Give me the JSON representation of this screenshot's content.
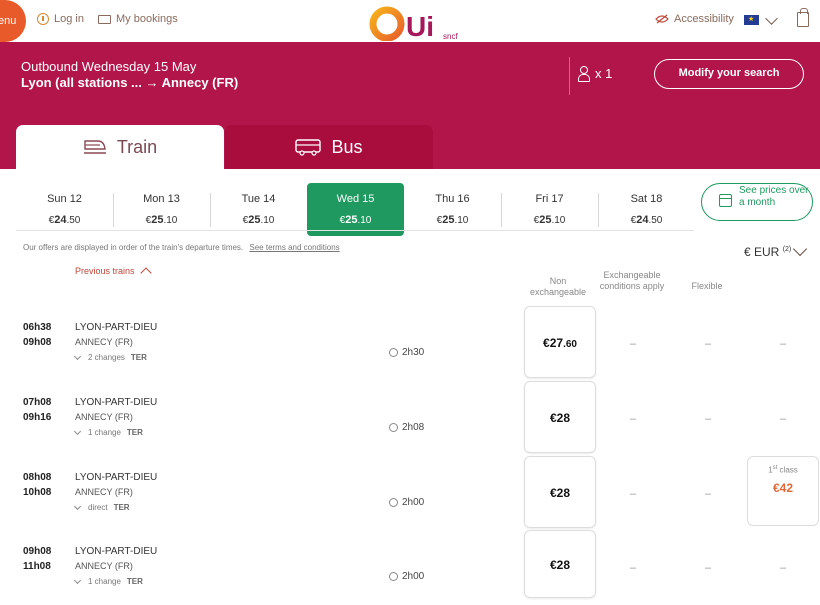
{
  "header": {
    "menu_label": "enu",
    "login_label": "Log in",
    "bookings_label": "My bookings",
    "logo_text": "Ui",
    "logo_sub": "sncf",
    "accessibility_label": "Accessibility"
  },
  "search": {
    "outbound": "Outbound Wednesday 15 May",
    "route": "Lyon (all stations ... → Annecy (FR)",
    "passengers": "x 1",
    "modify_label": "Modify your search"
  },
  "modes": [
    {
      "label": "Train"
    },
    {
      "label": "Bus"
    }
  ],
  "dates": [
    {
      "day": "Sun 12",
      "cur": "€",
      "int": "24",
      "dec": ".50"
    },
    {
      "day": "Mon 13",
      "cur": "€",
      "int": "25",
      "dec": ".10"
    },
    {
      "day": "Tue 14",
      "cur": "€",
      "int": "25",
      "dec": ".10"
    },
    {
      "day": "Wed 15",
      "cur": "€",
      "int": "25",
      "dec": ".10"
    },
    {
      "day": "Thu 16",
      "cur": "€",
      "int": "25",
      "dec": ".10"
    },
    {
      "day": "Fri 17",
      "cur": "€",
      "int": "25",
      "dec": ".10"
    },
    {
      "day": "Sat 18",
      "cur": "€",
      "int": "24",
      "dec": ".50"
    }
  ],
  "month_prices": "See prices over a month",
  "info_text": "Our offers are displayed in order of the train's departure times.",
  "terms_link": "See terms and conditions",
  "currency": {
    "label": "€ EUR",
    "note": "(2)"
  },
  "previous_trains": "Previous trains",
  "columns": {
    "non_exchangeable": "Non exchangeable",
    "exchangeable": "Exchangeable conditions apply",
    "flexible": "Flexible"
  },
  "trains": [
    {
      "dep": "06h38",
      "arr": "09h08",
      "from": "LYON-PART-DIEU",
      "to": "ANNECY (FR)",
      "changes": "2 changes",
      "type": "TER",
      "duration": "2h30",
      "price_int": "€27",
      "price_dec": ".60",
      "exch": "–",
      "flex": "–",
      "first": "–"
    },
    {
      "dep": "07h08",
      "arr": "09h16",
      "from": "LYON-PART-DIEU",
      "to": "ANNECY (FR)",
      "changes": "1 change",
      "type": "TER",
      "duration": "2h08",
      "price_int": "€28",
      "price_dec": "",
      "exch": "–",
      "flex": "–",
      "first": "–"
    },
    {
      "dep": "08h08",
      "arr": "10h08",
      "from": "LYON-PART-DIEU",
      "to": "ANNECY (FR)",
      "changes": "direct",
      "type": "TER",
      "duration": "2h00",
      "price_int": "€28",
      "price_dec": "",
      "exch": "–",
      "flex": "–",
      "first_class_label": "1",
      "first_class_sup": "st",
      "first_class_word": " class",
      "first_price": "€42"
    },
    {
      "dep": "09h08",
      "arr": "11h08",
      "from": "LYON-PART-DIEU",
      "to": "ANNECY (FR)",
      "changes": "1 change",
      "type": "TER",
      "duration": "2h00",
      "price_int": "€28",
      "price_dec": "",
      "exch": "–",
      "flex": "–",
      "first": "–"
    }
  ],
  "colors": {
    "brand": "#b2154a",
    "selected": "#1f9960",
    "accent": "#e85a2a"
  }
}
